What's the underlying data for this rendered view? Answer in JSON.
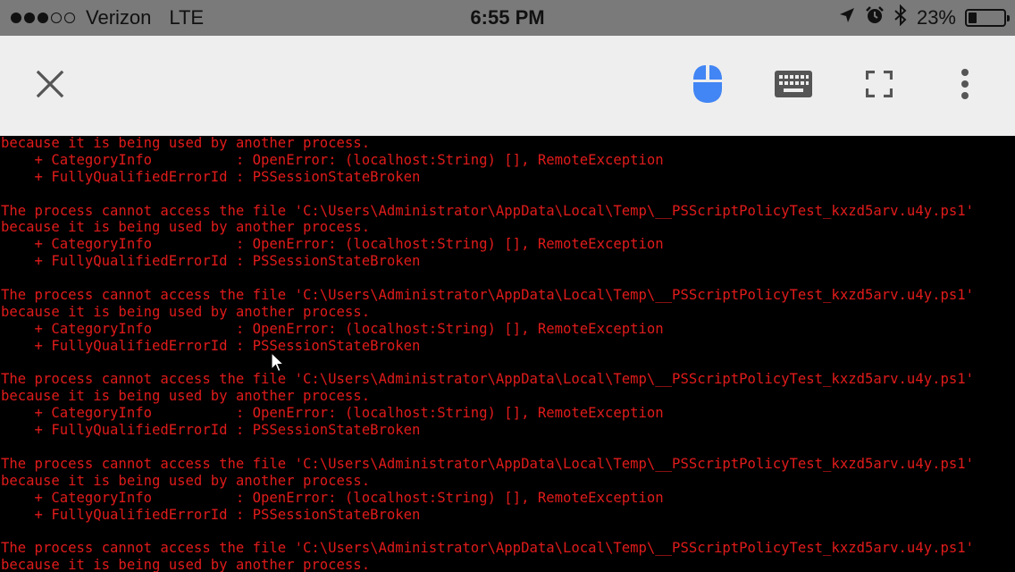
{
  "status_bar": {
    "signal_bars_filled": 3,
    "signal_bars_total": 5,
    "carrier": "Verizon",
    "network": "LTE",
    "time": "6:55 PM",
    "battery_percent_label": "23%",
    "battery_level": 0.23,
    "icons": [
      "location-arrow-icon",
      "alarm-clock-icon",
      "bluetooth-icon",
      "battery-icon"
    ]
  },
  "toolbar": {
    "icons": [
      "close-icon",
      "mouse-icon",
      "keyboard-icon",
      "fullscreen-icon",
      "more-vertical-icon"
    ],
    "active_icon": "mouse-icon",
    "accent_color": "#4285f4",
    "icon_color": "#555555"
  },
  "terminal": {
    "text_color": "#e01b1b",
    "background": "#000000",
    "lines": [
      "because it is being used by another process.",
      "    + CategoryInfo          : OpenError: (localhost:String) [], RemoteException",
      "    + FullyQualifiedErrorId : PSSessionStateBroken",
      "",
      "The process cannot access the file 'C:\\Users\\Administrator\\AppData\\Local\\Temp\\__PSScriptPolicyTest_kxzd5arv.u4y.ps1'",
      "because it is being used by another process.",
      "    + CategoryInfo          : OpenError: (localhost:String) [], RemoteException",
      "    + FullyQualifiedErrorId : PSSessionStateBroken",
      "",
      "The process cannot access the file 'C:\\Users\\Administrator\\AppData\\Local\\Temp\\__PSScriptPolicyTest_kxzd5arv.u4y.ps1'",
      "because it is being used by another process.",
      "    + CategoryInfo          : OpenError: (localhost:String) [], RemoteException",
      "    + FullyQualifiedErrorId : PSSessionStateBroken",
      "",
      "The process cannot access the file 'C:\\Users\\Administrator\\AppData\\Local\\Temp\\__PSScriptPolicyTest_kxzd5arv.u4y.ps1'",
      "because it is being used by another process.",
      "    + CategoryInfo          : OpenError: (localhost:String) [], RemoteException",
      "    + FullyQualifiedErrorId : PSSessionStateBroken",
      "",
      "The process cannot access the file 'C:\\Users\\Administrator\\AppData\\Local\\Temp\\__PSScriptPolicyTest_kxzd5arv.u4y.ps1'",
      "because it is being used by another process.",
      "    + CategoryInfo          : OpenError: (localhost:String) [], RemoteException",
      "    + FullyQualifiedErrorId : PSSessionStateBroken",
      "",
      "The process cannot access the file 'C:\\Users\\Administrator\\AppData\\Local\\Temp\\__PSScriptPolicyTest_kxzd5arv.u4y.ps1'",
      "because it is being used by another process."
    ]
  }
}
